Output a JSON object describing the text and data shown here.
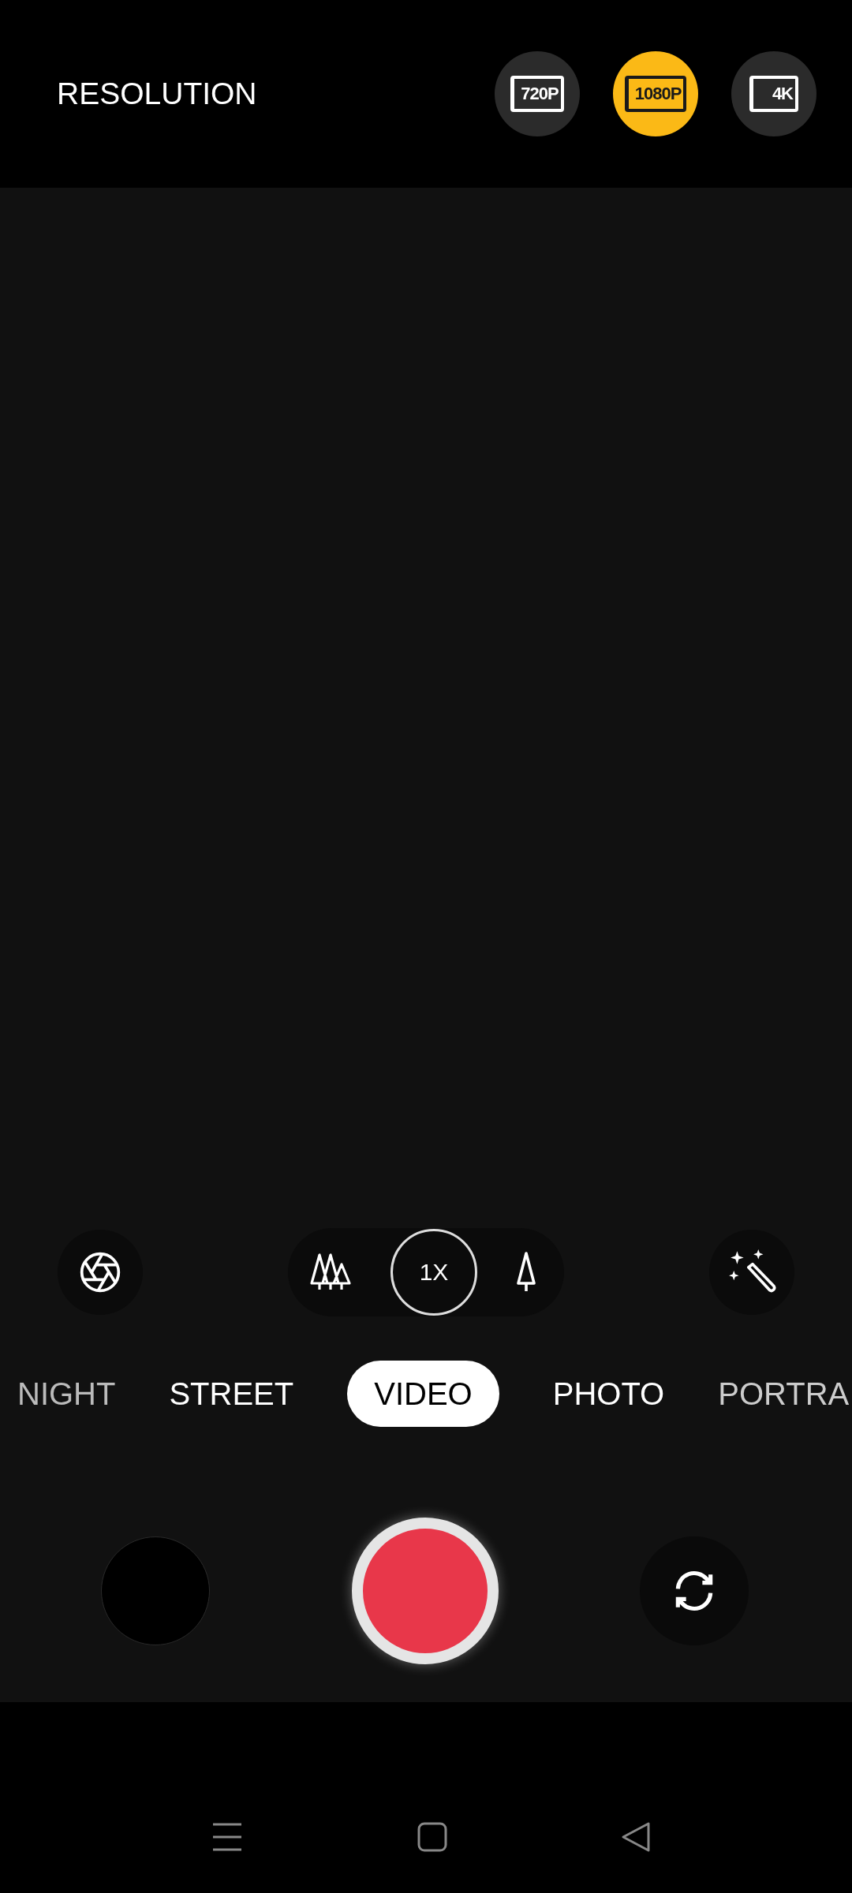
{
  "top_bar": {
    "title": "RESOLUTION",
    "options": [
      {
        "label": "720P",
        "selected": false
      },
      {
        "label": "1080P",
        "selected": true
      },
      {
        "label": "4K",
        "selected": false
      }
    ]
  },
  "zoom": {
    "label": "1X"
  },
  "modes": [
    {
      "label": "NIGHT",
      "selected": false
    },
    {
      "label": "STREET",
      "selected": false
    },
    {
      "label": "VIDEO",
      "selected": true
    },
    {
      "label": "PHOTO",
      "selected": false
    },
    {
      "label": "PORTRA",
      "selected": false
    }
  ]
}
